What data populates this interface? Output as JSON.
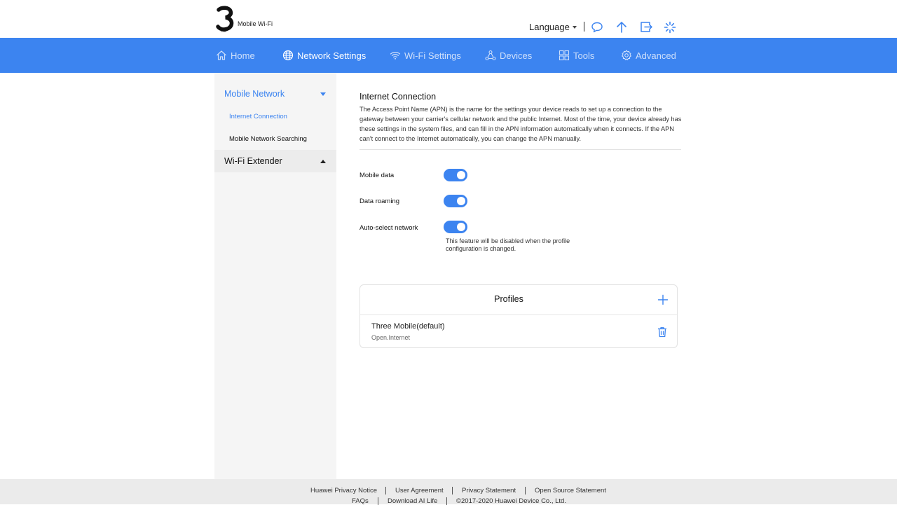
{
  "header": {
    "logo_text": "Mobile Wi-Fi",
    "language_label": "Language",
    "icons": [
      "message-icon",
      "upload-icon",
      "logout-icon",
      "loading-icon"
    ]
  },
  "nav": {
    "items": [
      {
        "label": "Home",
        "icon": "home-icon"
      },
      {
        "label": "Network Settings",
        "icon": "globe-icon",
        "active": true
      },
      {
        "label": "Wi-Fi Settings",
        "icon": "wifi-icon"
      },
      {
        "label": "Devices",
        "icon": "devices-icon"
      },
      {
        "label": "Tools",
        "icon": "tools-icon"
      },
      {
        "label": "Advanced",
        "icon": "gear-icon"
      }
    ],
    "background": "#3c84f0"
  },
  "sidebar": {
    "groups": [
      {
        "label": "Mobile Network",
        "expanded": true,
        "items": [
          {
            "label": "Internet Connection",
            "selected": true
          },
          {
            "label": "Mobile Network Searching",
            "selected": false
          }
        ]
      },
      {
        "label": "Wi-Fi Extender",
        "expanded": false
      }
    ]
  },
  "main": {
    "title": "Internet Connection",
    "description": "The Access Point Name (APN) is the name for the settings your device reads to set up a connection to the gateway between your carrier's cellular network and the public Internet. Most of the time, your device already has these settings in the system files, and can fill in the APN information automatically when it connects. If the APN can't connect to the Internet automatically, you can change the APN manually.",
    "settings": [
      {
        "label": "Mobile data",
        "enabled": true
      },
      {
        "label": "Data roaming",
        "enabled": true
      },
      {
        "label": "Auto-select network",
        "enabled": true
      }
    ],
    "auto_select_hint": "This feature will be disabled when the profile configuration is changed.",
    "profiles": {
      "title": "Profiles",
      "items": [
        {
          "name": "Three Mobile(default)",
          "apn": "Open.Internet"
        }
      ]
    }
  },
  "footer": {
    "links_row1": [
      "Huawei Privacy Notice",
      "User Agreement",
      "Privacy Statement",
      "Open Source Statement"
    ],
    "links_row2": [
      "FAQs",
      "Download AI Life"
    ],
    "copyright": "©2017-2020 Huawei Device Co., Ltd."
  },
  "colors": {
    "accent": "#3c84f0",
    "sidebar_bg": "#f5f5f5",
    "footer_bg": "#ebebeb"
  }
}
